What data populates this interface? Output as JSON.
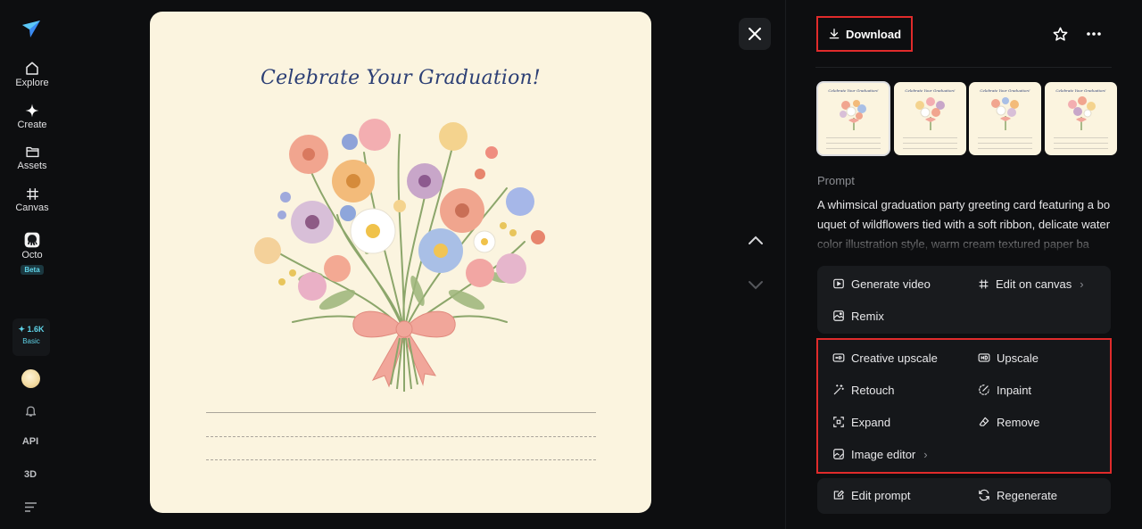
{
  "sidebar": {
    "items": [
      {
        "label": "Explore"
      },
      {
        "label": "Create"
      },
      {
        "label": "Assets"
      },
      {
        "label": "Canvas"
      },
      {
        "label": "Octo",
        "badge": "Beta"
      }
    ],
    "credits": {
      "amount": "✦ 1.6K",
      "plan": "Basic"
    },
    "api_label": "API",
    "three_d_label": "3D"
  },
  "image": {
    "card_title": "Celebrate Your Graduation!"
  },
  "toolbar": {
    "download_label": "Download"
  },
  "thumbnails": {
    "title_text": "Celebrate Your Graduation!"
  },
  "prompt": {
    "label": "Prompt",
    "text": "A whimsical graduation party greeting card featuring a bouquet of wildflowers tied with a soft ribbon, delicate watercolor illustration style, warm cream textured paper ba"
  },
  "actions": {
    "generate_video": "Generate video",
    "edit_on_canvas": "Edit on canvas",
    "remix": "Remix",
    "creative_upscale": "Creative upscale",
    "upscale": "Upscale",
    "retouch": "Retouch",
    "inpaint": "Inpaint",
    "expand": "Expand",
    "remove": "Remove",
    "image_editor": "Image editor",
    "edit_prompt": "Edit prompt",
    "regenerate": "Regenerate"
  },
  "colors": {
    "background": "#0d0e10",
    "accent": "#5fd3e8",
    "highlight_border": "#e02b2b",
    "card_paper": "#fbf4df",
    "title_ink": "#2c3f75"
  }
}
